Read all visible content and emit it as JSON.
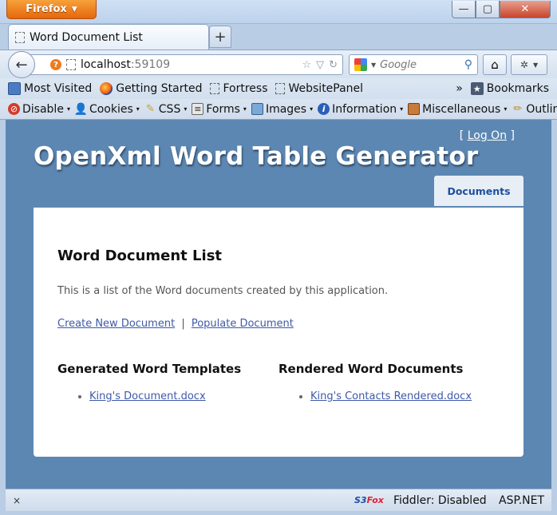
{
  "browser": {
    "menu_button": "Firefox",
    "window_controls": {
      "minimize": "—",
      "maximize": "▢",
      "close": "✕"
    },
    "tab": {
      "title": "Word Document List",
      "new_tab": "+"
    },
    "url": {
      "host": "localhost",
      "port": ":59109"
    },
    "search": {
      "placeholder": "Google"
    },
    "bookmarks": [
      "Most Visited",
      "Getting Started",
      "Fortress",
      "WebsitePanel"
    ],
    "bookmarks_overflow": "»",
    "bookmarks_menu": "Bookmarks",
    "dev_toolbar": [
      "Disable",
      "Cookies",
      "CSS",
      "Forms",
      "Images",
      "Information",
      "Miscellaneous",
      "Outline"
    ],
    "status": {
      "s3fox_a": "S3",
      "s3fox_b": "Fox",
      "fiddler": "Fiddler: Disabled",
      "aspnet": "ASP.NET",
      "close": "×"
    }
  },
  "page": {
    "login": {
      "open": "[",
      "link": "Log On",
      "close": "]"
    },
    "title": "OpenXml Word Table Generator",
    "nav_tab": "Documents",
    "heading": "Word Document List",
    "intro": "This is a list of the Word documents created by this application.",
    "links": {
      "create": "Create New Document",
      "separator": "|",
      "populate": "Populate Document"
    },
    "templates": {
      "heading": "Generated Word Templates",
      "items": [
        "King's Document.docx"
      ]
    },
    "rendered": {
      "heading": "Rendered Word Documents",
      "items": [
        "King's Contacts Rendered.docx"
      ]
    }
  }
}
